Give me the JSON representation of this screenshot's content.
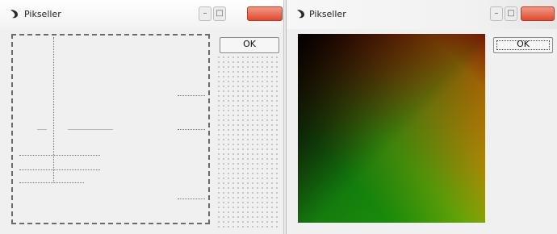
{
  "windows": {
    "left": {
      "title": "Pikseller",
      "ok_label": "OK",
      "icon": "app-icon"
    },
    "right": {
      "title": "Pikseller",
      "ok_label": "OK",
      "icon": "app-icon"
    }
  },
  "colors": {
    "gradient_top_left": "#000000",
    "gradient_top_right": "#ff2a1e",
    "gradient_bottom_left": "#22b24a",
    "gradient_bottom_right": "#ffe31a",
    "close_button": "#e04a2d"
  }
}
